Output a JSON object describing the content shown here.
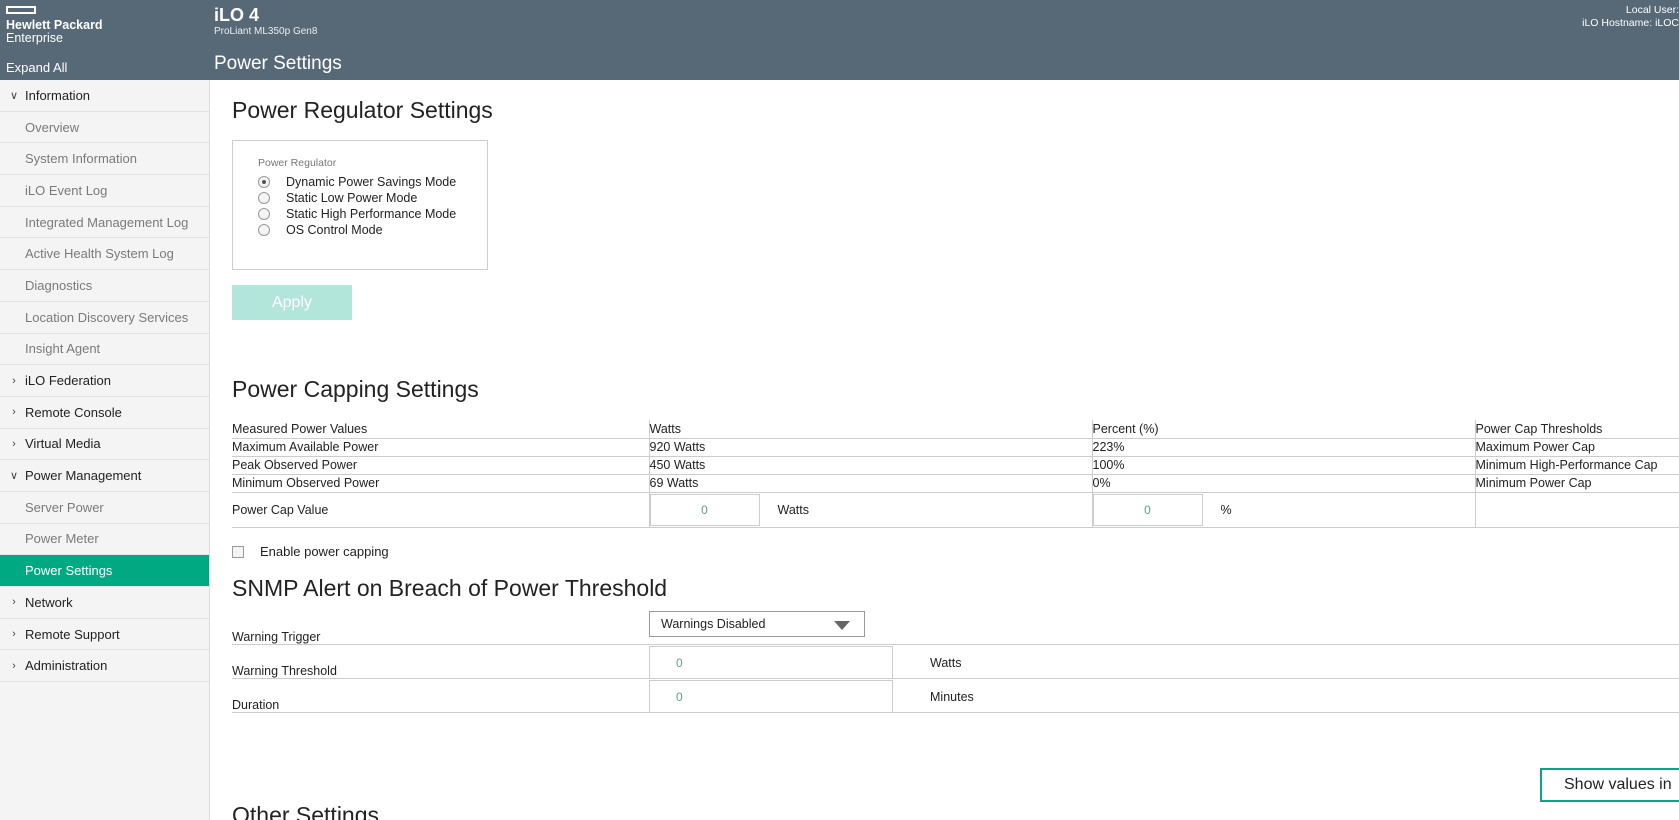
{
  "header": {
    "logo_line1": "Hewlett Packard",
    "logo_line2": "Enterprise",
    "expand_all": "Expand All",
    "product_title": "iLO 4",
    "product_subtitle": "ProLiant ML350p Gen8",
    "page_title": "Power Settings",
    "user_label": "Local User:",
    "hostname_label": "iLO Hostname: iLOC"
  },
  "sidebar": {
    "items": [
      {
        "label": "Information",
        "type": "group",
        "icon": "chevron-down-icon"
      },
      {
        "label": "Overview",
        "type": "sub"
      },
      {
        "label": "System Information",
        "type": "sub"
      },
      {
        "label": "iLO Event Log",
        "type": "sub"
      },
      {
        "label": "Integrated Management Log",
        "type": "sub"
      },
      {
        "label": "Active Health System Log",
        "type": "sub"
      },
      {
        "label": "Diagnostics",
        "type": "sub"
      },
      {
        "label": "Location Discovery Services",
        "type": "sub"
      },
      {
        "label": "Insight Agent",
        "type": "sub"
      },
      {
        "label": "iLO Federation",
        "type": "group",
        "icon": "chevron-right-icon"
      },
      {
        "label": "Remote Console",
        "type": "group",
        "icon": "chevron-right-icon"
      },
      {
        "label": "Virtual Media",
        "type": "group",
        "icon": "chevron-right-icon"
      },
      {
        "label": "Power Management",
        "type": "group",
        "icon": "chevron-down-icon"
      },
      {
        "label": "Server Power",
        "type": "sub"
      },
      {
        "label": "Power Meter",
        "type": "sub"
      },
      {
        "label": "Power Settings",
        "type": "sub",
        "active": true
      },
      {
        "label": "Network",
        "type": "group",
        "icon": "chevron-right-icon"
      },
      {
        "label": "Remote Support",
        "type": "group",
        "icon": "chevron-right-icon"
      },
      {
        "label": "Administration",
        "type": "group",
        "icon": "chevron-right-icon"
      }
    ]
  },
  "regulator": {
    "heading": "Power Regulator Settings",
    "legend": "Power Regulator",
    "options": [
      {
        "label": "Dynamic Power Savings Mode",
        "checked": true
      },
      {
        "label": "Static Low Power Mode",
        "checked": false
      },
      {
        "label": "Static High Performance Mode",
        "checked": false
      },
      {
        "label": "OS Control Mode",
        "checked": false
      }
    ],
    "apply_label": "Apply"
  },
  "capping": {
    "heading": "Power Capping Settings",
    "columns": [
      "Measured Power Values",
      "Watts",
      "Percent (%)",
      "Power Cap Thresholds"
    ],
    "rows": [
      [
        "Maximum Available Power",
        "920 Watts",
        "223%",
        "Maximum Power Cap"
      ],
      [
        "Peak Observed Power",
        "450 Watts",
        "100%",
        "Minimum High-Performance Cap"
      ],
      [
        "Minimum Observed Power",
        "69 Watts",
        "0%",
        "Minimum Power Cap"
      ]
    ],
    "cap_value_label": "Power Cap Value",
    "watts_value": "0",
    "watts_unit": "Watts",
    "percent_value": "0",
    "percent_unit": "%",
    "enable_label": "Enable power capping"
  },
  "snmp": {
    "heading": "SNMP Alert on Breach of Power Threshold",
    "trigger_label": "Warning Trigger",
    "trigger_value": "Warnings Disabled",
    "threshold_label": "Warning Threshold",
    "threshold_value": "0",
    "threshold_unit": "Watts",
    "duration_label": "Duration",
    "duration_value": "0",
    "duration_unit": "Minutes"
  },
  "show_values_label": "Show values in",
  "other_heading": "Other Settings",
  "colors": {
    "header_bg": "#576977",
    "accent": "#01a982",
    "apply_disabled": "#b2e6da"
  }
}
